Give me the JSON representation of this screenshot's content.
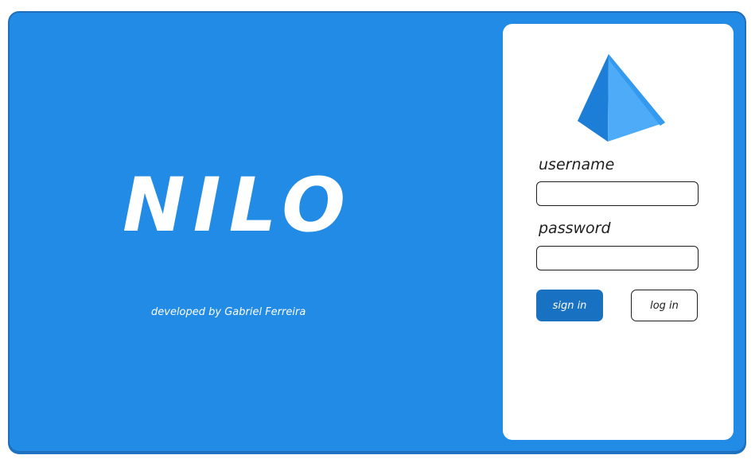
{
  "brand": {
    "title": "NILO",
    "credit": "developed by Gabriel Ferreira"
  },
  "login_card": {
    "logo_icon": "pyramid-icon",
    "username_label": "username",
    "username_value": "",
    "password_label": "password",
    "password_value": "",
    "sign_in_label": "sign in",
    "log_in_label": "log in"
  },
  "colors": {
    "background": "#228be6",
    "primary_button": "#1971c2",
    "card": "#ffffff",
    "text_dark": "#1e1e1e",
    "logo_light": "#4dabf7",
    "logo_dark": "#1c7ed6"
  }
}
